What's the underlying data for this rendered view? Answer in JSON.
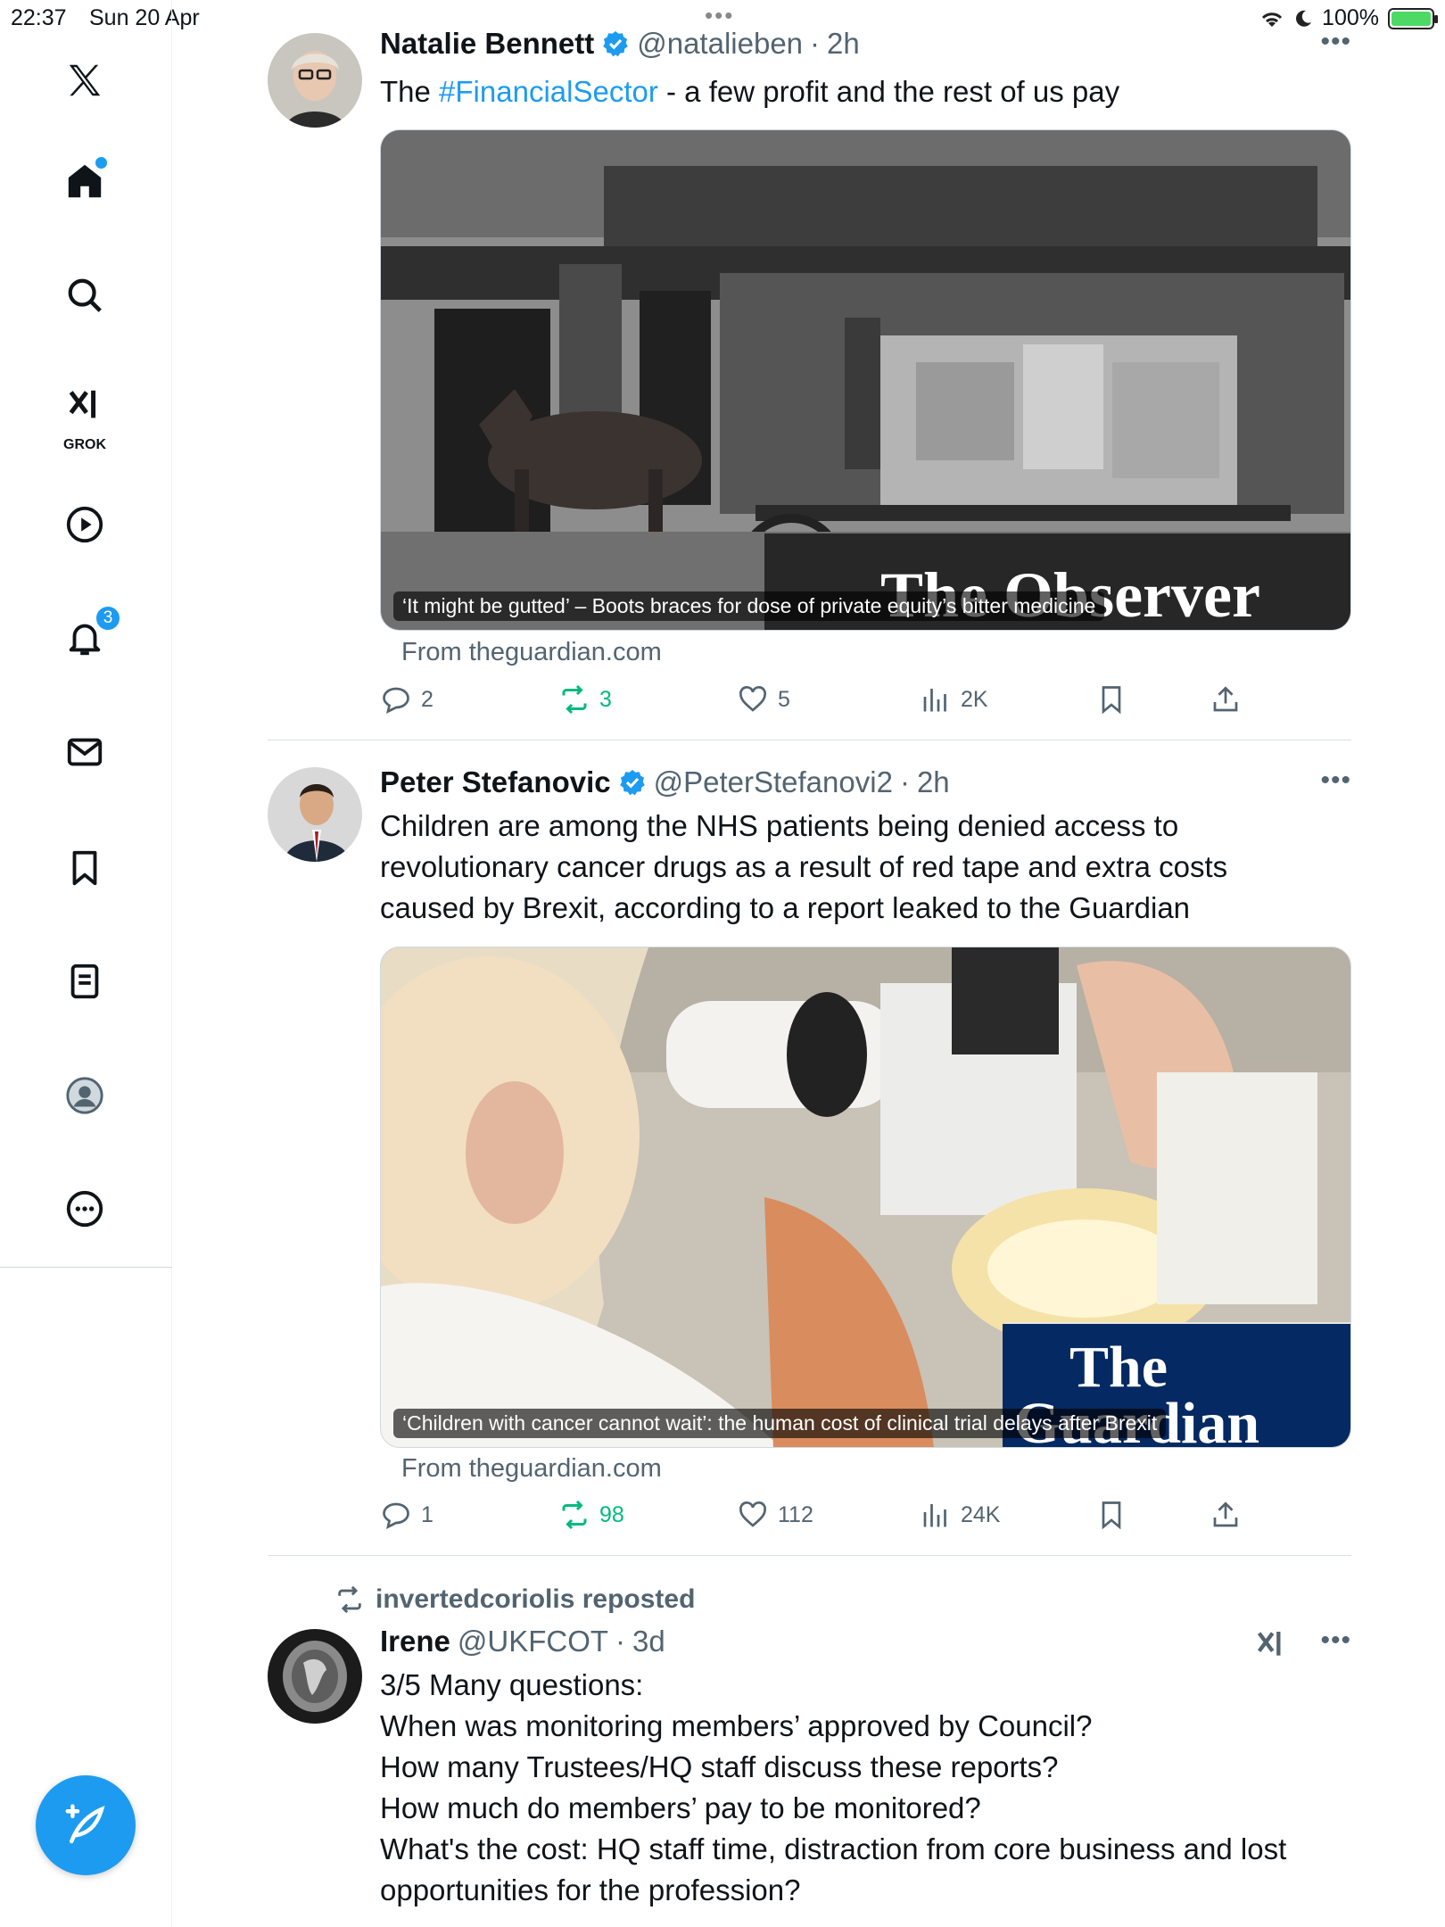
{
  "status_bar": {
    "time": "22:37",
    "date": "Sun 20 Apr",
    "battery": "100%"
  },
  "sidebar": {
    "grok_label": "GROK",
    "notifications_count": "3"
  },
  "tweets": [
    {
      "name": "Natalie Bennett",
      "handle": "@natalieben",
      "time": "2h",
      "text_prefix": "The ",
      "hashtag": "#FinancialSector",
      "text_suffix": " - a few profit and the rest of us pay",
      "caption": "‘It might be gutted’ – Boots braces for dose of private equity’s bitter medicine",
      "card_logo": "The Observer",
      "source": "From theguardian.com",
      "replies": "2",
      "reposts": "3",
      "likes": "5",
      "views": "2K"
    },
    {
      "name": "Peter Stefanovic",
      "handle": "@PeterStefanovi2",
      "time": "2h",
      "text_lines": [
        "Children are among the NHS patients being denied access to",
        "revolutionary cancer drugs as a result of red tape and extra costs",
        "caused by Brexit, according to a report leaked to the Guardian"
      ],
      "caption": "‘Children with cancer cannot wait’: the human cost of clinical trial delays after Brexit",
      "card_logo_1": "The",
      "card_logo_2": "Guardian",
      "source": "From theguardian.com",
      "replies": "1",
      "reposts": "98",
      "likes": "112",
      "views": "24K"
    },
    {
      "reposted_by": "invertedcoriolis reposted",
      "name": "Irene",
      "handle": "@UKFCOT",
      "time": "3d",
      "text_lines": [
        "3/5  Many questions:",
        "When was monitoring members’ approved by Council?",
        "How many Trustees/HQ staff discuss these reports?",
        "How much do members’ pay to be monitored?",
        "What's the cost:  HQ staff time,  distraction from core business and lost",
        "opportunities for the profession?"
      ]
    }
  ],
  "colors": {
    "accent": "#1d9bf0",
    "repost_green": "#00ba7c",
    "secondary_text": "#536471"
  }
}
